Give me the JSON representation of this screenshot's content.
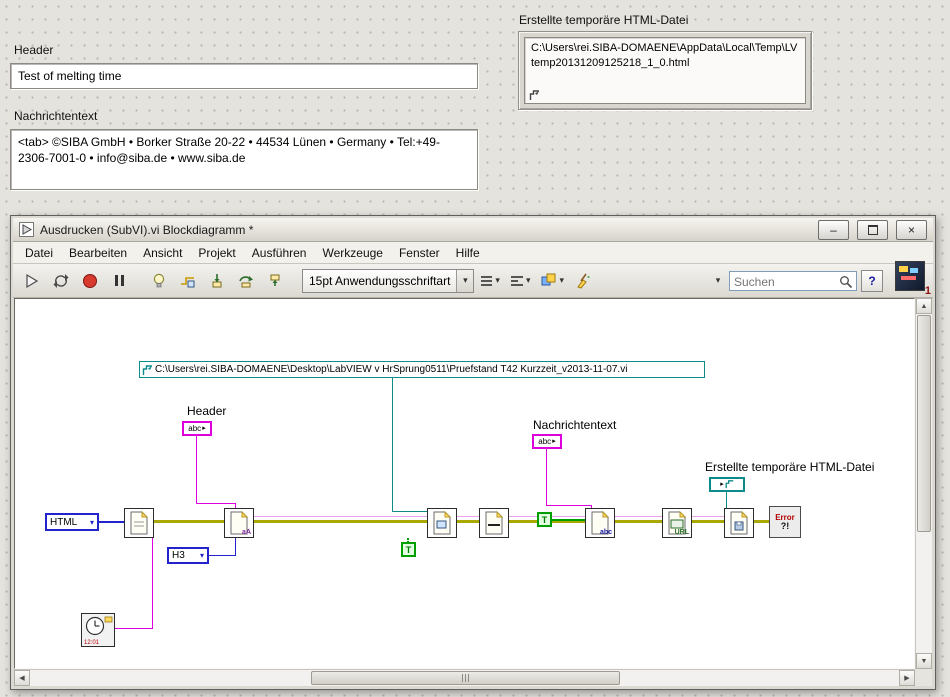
{
  "front_panel": {
    "header_label": "Header",
    "header_value": "Test of melting time",
    "message_label": "Nachrichtentext",
    "message_value": "<tab> ©SIBA GmbH • Borker Straße 20-22 • 44534 Lünen • Germany • Tel:+49-2306-7001-0 • info@siba.de • www.siba.de",
    "html_file_label": "Erstellte temporäre HTML-Datei",
    "html_file_value": "C:\\Users\\rei.SIBA-DOMAENE\\AppData\\Local\\Temp\\LVtemp20131209125218_1_0.html"
  },
  "window": {
    "title": "Ausdrucken (SubVI).vi Blockdiagramm *",
    "menu": [
      "Datei",
      "Bearbeiten",
      "Ansicht",
      "Projekt",
      "Ausführen",
      "Werkzeuge",
      "Fenster",
      "Hilfe"
    ],
    "toolbar": {
      "font_selector": "15pt Anwendungsschriftart",
      "search_placeholder": "Suchen",
      "help_label": "?"
    },
    "vi_icon_badge": "1"
  },
  "diagram": {
    "vi_path": "C:\\Users\\rei.SIBA-DOMAENE\\Desktop\\LabVIEW v HrSprung0511\\Pruefstand T42 Kurzzeit_v2013-11-07.vi",
    "header_label": "Header",
    "message_label": "Nachrichtentext",
    "html_file_label": "Erstellte temporäre HTML-Datei",
    "terminal_abc": "abc",
    "enum_html": "HTML",
    "enum_h3": "H3",
    "bool_true": "T",
    "clock_text": "12:01",
    "error_line1": "Error",
    "error_line2": "?!",
    "vi_glyphs": {
      "set_font": "aA",
      "horizontal_line": "—",
      "append_text": "abc",
      "append_url": "URL"
    }
  },
  "icons": {
    "dropdown_arrow": "▾",
    "minimize_glyph": "–",
    "close_glyph": "×",
    "scroll_up_glyph": "▲",
    "scroll_down_glyph": "▼",
    "scroll_left_glyph": "◀",
    "scroll_right_glyph": "▶",
    "control_arrow_glyph": "▸"
  },
  "colors": {
    "string_pink": "#dd00dd",
    "path_teal": "#0d8a8a",
    "enum_blue": "#2323cc",
    "bool_green": "#00a000",
    "wire_olive": "#a8a800"
  }
}
